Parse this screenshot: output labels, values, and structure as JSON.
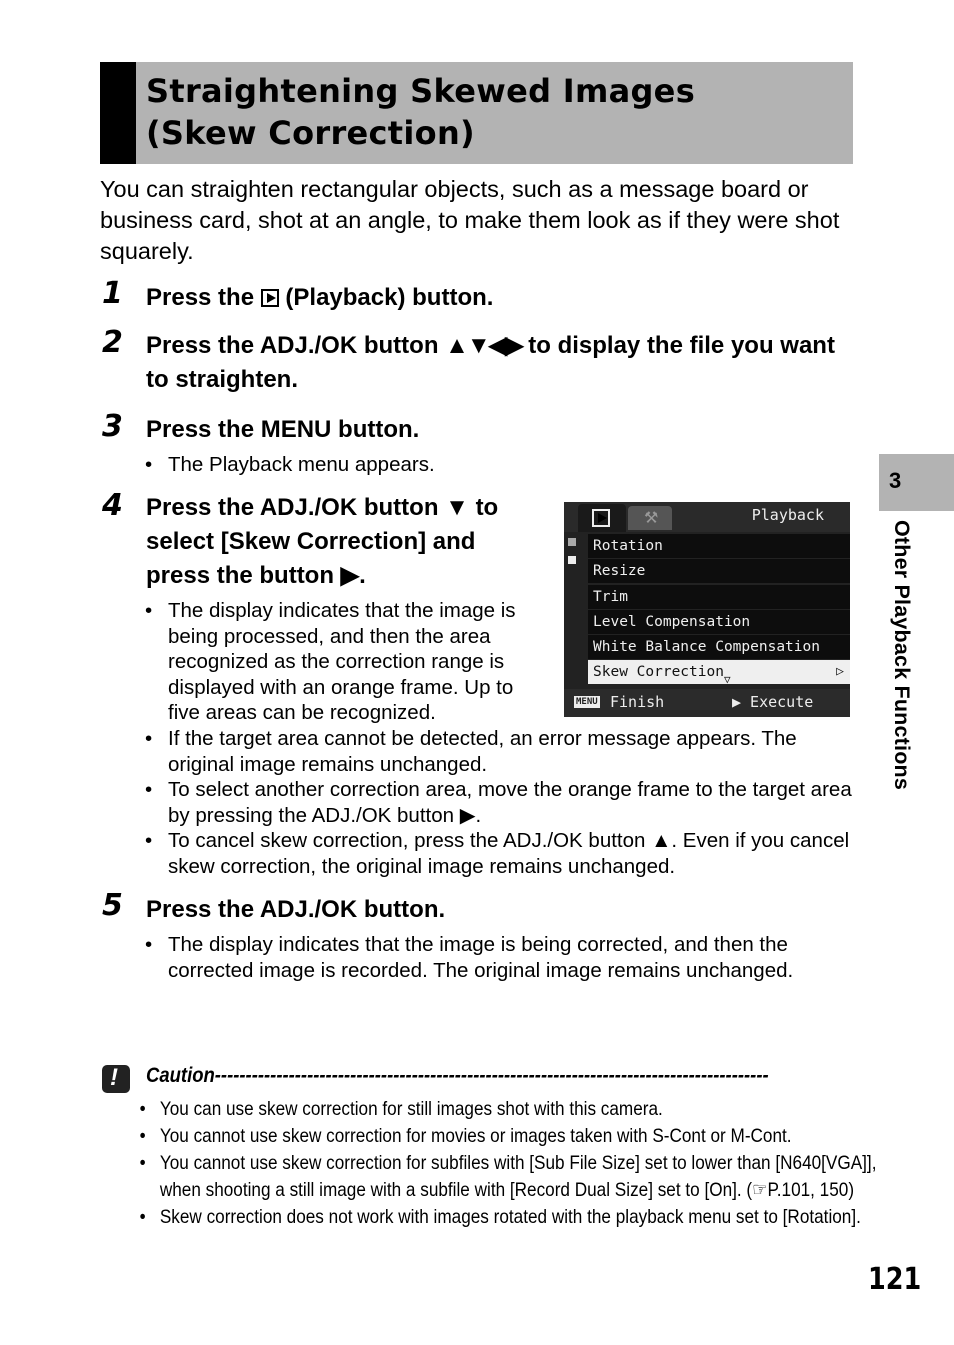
{
  "header": {
    "title_line1": "Straightening Skewed Images",
    "title_line2": "(Skew Correction)"
  },
  "intro": "You can straighten rectangular objects, such as a message board or business card, shot at an angle, to make them look as if they were shot squarely.",
  "steps": [
    {
      "num": "1",
      "title_before": "Press the",
      "icon": "playback-icon",
      "title_after": "(Playback) button."
    },
    {
      "num": "2",
      "title_before": "Press the ADJ./OK button",
      "arrows": "▲▼◀▶",
      "title_after": "to display the file you want to straighten."
    },
    {
      "num": "3",
      "title": "Press the MENU button.",
      "notes": [
        "The Playback menu appears."
      ]
    },
    {
      "num": "4",
      "title_line1": "Press the ADJ./OK button ▼ to",
      "title_line2": "select [Skew Correction] and",
      "title_line3": "press the button ▶.",
      "notes": [
        "The display indicates that the image is being processed, and then the area recognized as the correction range is displayed with an orange frame. Up to five areas can be recognized.",
        "If the target area cannot be detected, an error message appears. The original image remains unchanged.",
        "To select another correction area, move the orange frame to the target area by pressing the ADJ./OK button ▶.",
        "To cancel skew correction, press the ADJ./OK button ▲. Even if you cancel skew correction, the original image remains unchanged."
      ]
    },
    {
      "num": "5",
      "title": "Press the ADJ./OK button.",
      "notes": [
        "The display indicates that the image is being corrected, and then the corrected image is recorded. The original image remains unchanged."
      ]
    }
  ],
  "camera_screen": {
    "tab_title": "Playback",
    "items": [
      "Rotation",
      "Resize",
      "Trim",
      "Level Compensation",
      "White Balance Compensation",
      "Skew Correction"
    ],
    "selected_index": 5,
    "footer_left_key": "MENU",
    "footer_left": "Finish",
    "footer_right": "▶ Execute"
  },
  "side_tab": {
    "chapter": "3",
    "label": "Other Playback Functions"
  },
  "caution": {
    "heading": "Caution------------------------------------------------------------------------------------------",
    "items": [
      "You can use skew correction for still images shot with this camera.",
      "You cannot use skew correction for movies or images taken with S-Cont or M-Cont.",
      "You cannot use skew correction for subfiles with [Sub File Size] set to lower than [N640[VGA]], when shooting a still image with a subfile with [Record Dual Size] set to [On]. (☞P.101, 150)",
      "Skew correction does not work with images rotated with the playback menu set to [Rotation]."
    ]
  },
  "page_number": "121"
}
